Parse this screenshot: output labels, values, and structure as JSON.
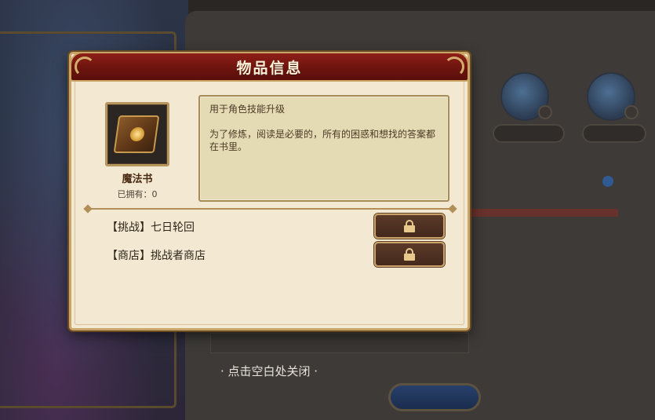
{
  "dialog": {
    "title": "物品信息",
    "item": {
      "name": "魔法书",
      "owned": "已拥有：0",
      "icon": "magic-book-icon"
    },
    "description": {
      "summary": "用于角色技能升级",
      "flavor": "为了修炼，阅读是必要的，所有的困惑和想找的答案都在书里。"
    },
    "sources": [
      {
        "label": "【挑战】七日轮回",
        "button_icon": "lock-icon"
      },
      {
        "label": "【商店】挑战者商店",
        "button_icon": "lock-icon"
      }
    ]
  },
  "hint": "· 点击空白处关闭 ·",
  "colors": {
    "header": "#7a1a12",
    "parchment": "#f3e9d3",
    "gold_trim": "#c9a56a",
    "button": "#4e3222"
  }
}
